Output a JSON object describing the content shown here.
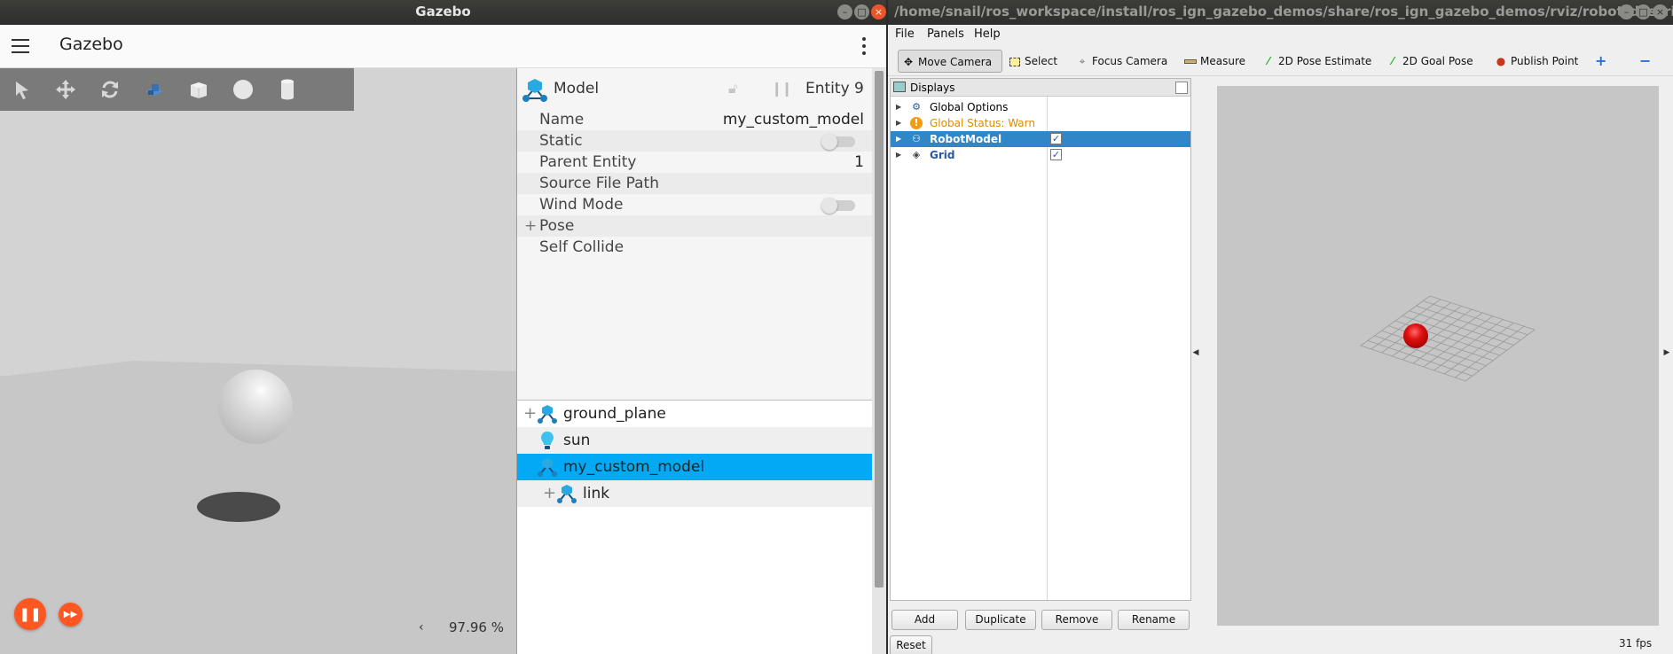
{
  "gazebo": {
    "window_title": "Gazebo",
    "app_title": "Gazebo",
    "toolbar_icons": [
      "select-icon",
      "translate-icon",
      "rotate-icon",
      "transform-control-icon",
      "box-icon",
      "sphere-icon",
      "cylinder-icon"
    ],
    "inspector": {
      "title": "Model",
      "entity": "Entity 9",
      "rows": [
        {
          "key": "Name",
          "value": "my_custom_model"
        },
        {
          "key": "Static",
          "toggle": false
        },
        {
          "key": "Parent Entity",
          "value": "1"
        },
        {
          "key": "Source File Path",
          "value": ""
        },
        {
          "key": "Wind Mode",
          "toggle": false
        },
        {
          "key": "Pose",
          "expandable": true
        },
        {
          "key": "Self Collide",
          "value": ""
        }
      ]
    },
    "tree": [
      {
        "label": "ground_plane",
        "icon": "model-icon",
        "expandable": true,
        "level": 0
      },
      {
        "label": "sun",
        "icon": "light-bulb-icon",
        "expandable": false,
        "level": 0
      },
      {
        "label": "my_custom_model",
        "icon": "model-icon",
        "expandable": false,
        "selected": true,
        "level": 0
      },
      {
        "label": "link",
        "icon": "model-icon",
        "expandable": true,
        "level": 1
      }
    ],
    "real_time_factor": "97.96 %",
    "accent": "#ff5722",
    "selection_color": "#03a9f4"
  },
  "rviz": {
    "window_title": "/home/snail/ros_workspace/install/ros_ign_gazebo_demos/share/ros_ign_gazebo_demos/rviz/robot_description_...",
    "menus": [
      "File",
      "Panels",
      "Help"
    ],
    "tools": [
      {
        "label": "Move Camera",
        "icon": "move-camera-icon",
        "active": true
      },
      {
        "label": "Select",
        "icon": "select-icon"
      },
      {
        "label": "Focus Camera",
        "icon": "focus-camera-icon"
      },
      {
        "label": "Measure",
        "icon": "measure-icon"
      },
      {
        "label": "2D Pose Estimate",
        "icon": "pose-estimate-icon"
      },
      {
        "label": "2D Goal Pose",
        "icon": "goal-pose-icon"
      },
      {
        "label": "Publish Point",
        "icon": "publish-point-icon"
      }
    ],
    "displays_title": "Displays",
    "displays": [
      {
        "label": "Global Options",
        "icon": "gear-icon",
        "color": "#111111"
      },
      {
        "label": "Global Status: Warn",
        "icon": "warning-icon",
        "color": "#e08a00"
      },
      {
        "label": "RobotModel",
        "icon": "robot-icon",
        "checked": true,
        "selected": true
      },
      {
        "label": "Grid",
        "icon": "grid-icon",
        "checked": true,
        "color": "#2a57a8"
      }
    ],
    "buttons": {
      "add": "Add",
      "duplicate": "Duplicate",
      "remove": "Remove",
      "rename": "Rename",
      "reset": "Reset"
    },
    "fps": "31 fps",
    "check_mark": "✓"
  }
}
